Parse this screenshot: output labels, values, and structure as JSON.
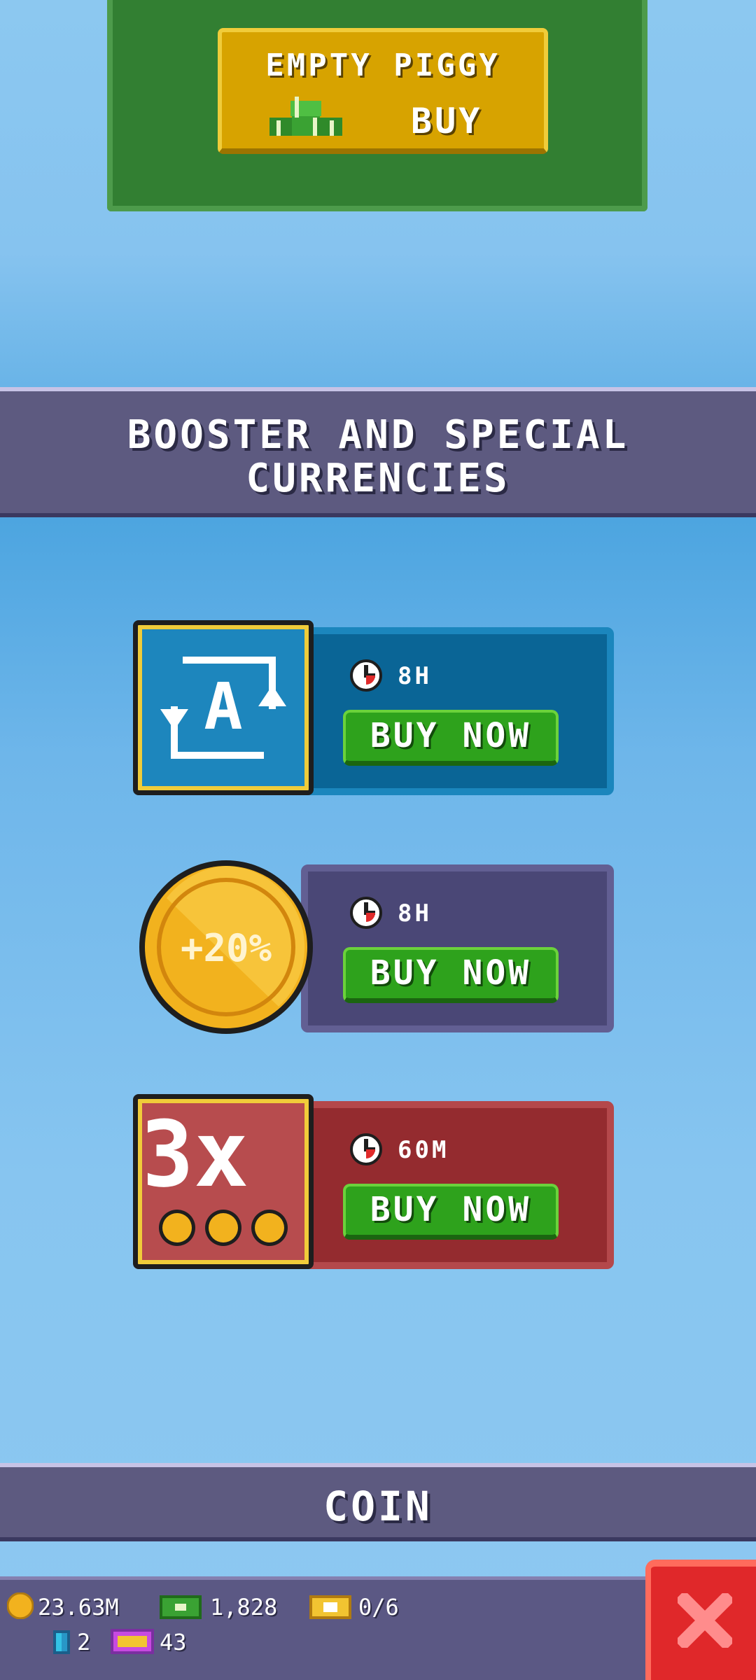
{
  "piggy": {
    "title": "EMPTY PIGGY",
    "buy_label": "BUY"
  },
  "booster_section": {
    "title_line1": "BOOSTER AND SPECIAL",
    "title_line2": "CURRENCIES"
  },
  "boosters": [
    {
      "icon": "auto-collect-icon",
      "duration": "8H",
      "button_label": "BUY NOW"
    },
    {
      "icon": "coin-boost-icon",
      "badge_text": "+20%",
      "duration": "8H",
      "button_label": "BUY NOW"
    },
    {
      "icon": "triple-coin-icon",
      "badge_text": "3x",
      "duration": "60M",
      "button_label": "BUY NOW"
    }
  ],
  "coin_section": {
    "title": "COIN"
  },
  "resources": {
    "coins": "23.63M",
    "cash": "1,828",
    "tickets": "0/6",
    "gems": "2",
    "vip": "43"
  },
  "colors": {
    "accent_green": "#2ea21c",
    "close_red": "#e0282a",
    "header_purple": "#5d5a80"
  }
}
